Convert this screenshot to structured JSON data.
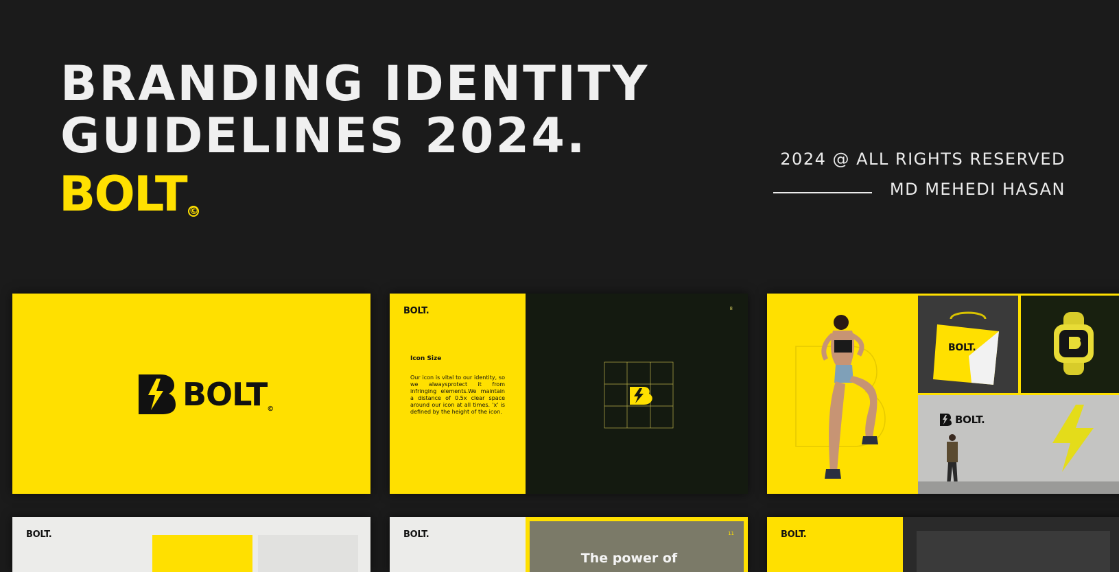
{
  "hero": {
    "title_line1": "BRANDING IDENTITY",
    "title_line2": "GUIDELINES 2024.",
    "logo_text": "BOLT",
    "logo_mark": "©",
    "rights": "2024 @ ALL RIGHTS RESERVED",
    "author": "MD MEHEDI HASAN"
  },
  "slides": {
    "s1": {
      "brand": "BOLT",
      "mark": "©"
    },
    "s2": {
      "brand": "BOLT.",
      "page_no": "8",
      "heading": "Icon Size",
      "body": "Our icon is vital to our identity, so we alwaysprotect it from infringing elements.We maintain a distance of 0.5x clear space around our icon at all times. 'x' is defined by the height of the icon."
    },
    "s3": {
      "bag_brand": "BOLT.",
      "wall_brand": "BOLT."
    },
    "s4": {
      "brand": "BOLT."
    },
    "s5": {
      "brand": "BOLT.",
      "page_no": "11",
      "headline": "The power of"
    },
    "s6": {
      "brand": "BOLT."
    }
  },
  "colors": {
    "background": "#1b1b1b",
    "brand_yellow": "#ffe000",
    "dark_panel": "#141a10",
    "off_white": "#ececea"
  }
}
